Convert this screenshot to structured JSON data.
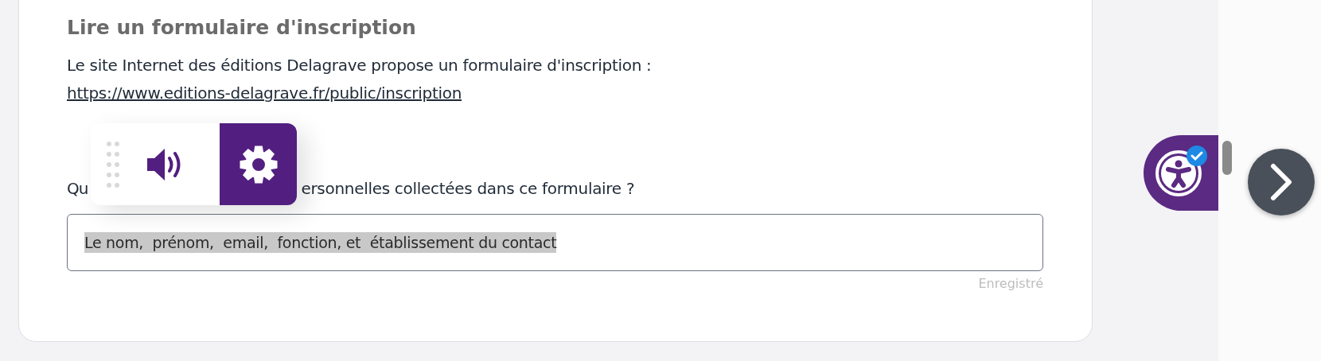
{
  "section_title": "Lire un formulaire d'inscription",
  "intro": {
    "text": "Le site Internet des éditions Delagrave propose un formulaire d'inscription :",
    "link": "https://www.editions-delagrave.fr/public/inscription"
  },
  "question_parts": [
    "Qu",
    "ersonnelles collectées dans ce formulaire ?"
  ],
  "answer": {
    "value": "Le nom,  prénom,  email,  fonction, et  établissement du contact",
    "value_selected": true
  },
  "save_status": "Enregistré",
  "reader_toolbar": {
    "settings_active": true
  },
  "accessibility_button": {
    "verified": true
  }
}
